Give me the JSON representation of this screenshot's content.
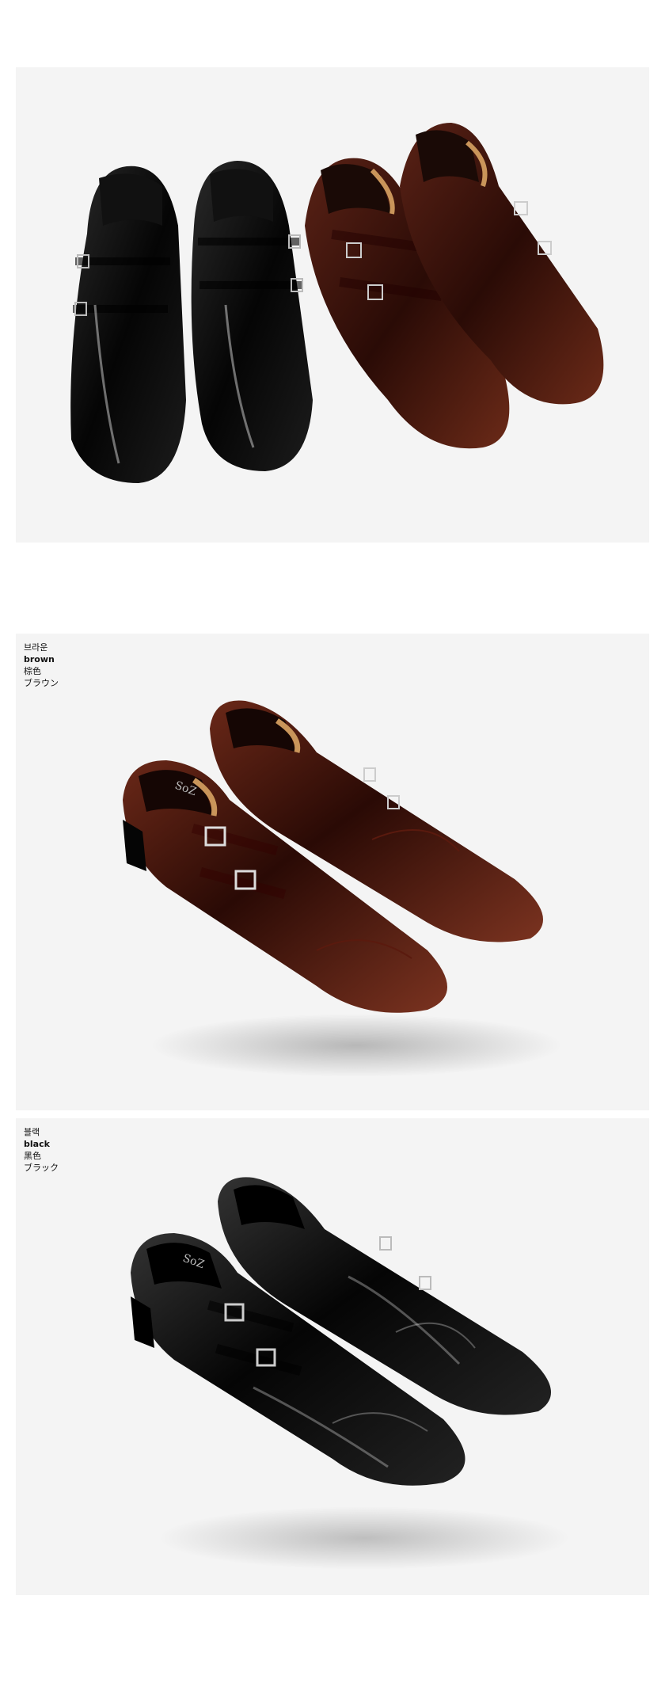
{
  "colors": {
    "panel_bg": "#f4f4f4",
    "black_leather": "#0d0d0d",
    "brown_leather": "#4a1810"
  },
  "variants": [
    {
      "color_key": "brown",
      "name_ko": "브라운",
      "name_en": "brown",
      "name_zh": "棕色",
      "name_ja": "ブラウン"
    },
    {
      "color_key": "black",
      "name_ko": "블랙",
      "name_en": "black",
      "name_zh": "黑色",
      "name_ja": "ブラック"
    }
  ],
  "insole_brand": "SoZ"
}
